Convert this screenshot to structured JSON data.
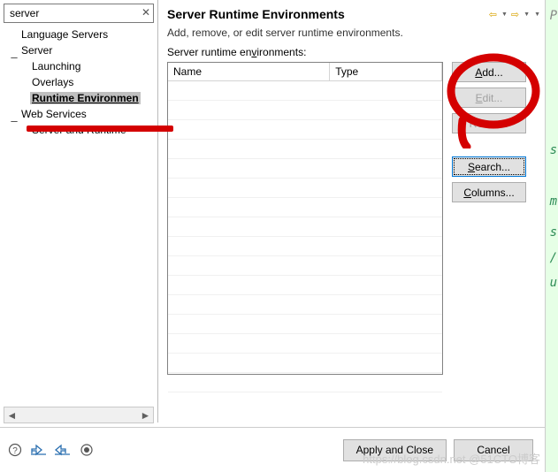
{
  "search": {
    "value": "server",
    "clear": "✕"
  },
  "tree": [
    {
      "label": "Language Servers",
      "indent": 18
    },
    {
      "label": "Server",
      "indent": 6,
      "expand": true
    },
    {
      "label": "Launching",
      "indent": 30
    },
    {
      "label": "Overlays",
      "indent": 30
    },
    {
      "label": "Runtime Environmen",
      "indent": 30,
      "selected": true
    },
    {
      "label": "Web Services",
      "indent": 6,
      "expand": true
    },
    {
      "label": "Server and Runtime",
      "indent": 30
    }
  ],
  "page": {
    "title": "Server Runtime Environments",
    "desc": "Add, remove, or edit server runtime environments.",
    "sub_pre": "Server runtime en",
    "sub_u": "v",
    "sub_post": "ironments:",
    "columns": {
      "name": "Name",
      "type": "Type"
    }
  },
  "buttons": {
    "add_u": "A",
    "add_post": "dd...",
    "edit_u": "E",
    "edit_post": "dit...",
    "remove": "Remove",
    "search_u": "S",
    "search_post": "earch...",
    "cols_u": "C",
    "cols_post": "olumns..."
  },
  "footer": {
    "apply": "Apply and Close",
    "cancel": "Cancel"
  },
  "sidechars": [
    "P",
    "s",
    "m",
    "s",
    "/",
    "u"
  ],
  "watermark": "https://blog.csdn.net @51CTO博客"
}
